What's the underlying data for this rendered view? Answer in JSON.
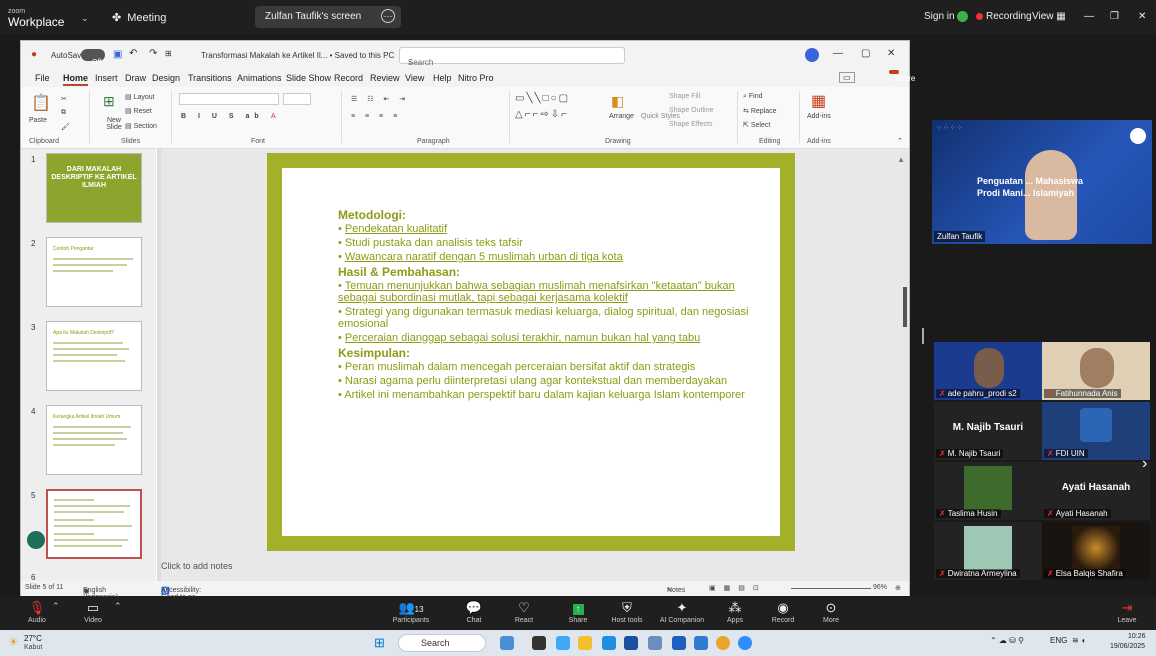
{
  "zoom": {
    "logo_top": "zoom",
    "logo_bottom": "Workplace",
    "meeting_label": "Meeting",
    "screen_tab": "Zulfan Taufik's screen",
    "sign_in": "Sign in",
    "recording": "Recording",
    "view": "View"
  },
  "ppt": {
    "autosave": "AutoSave",
    "autosave_state": "Off",
    "doc_title": "Transformasi Makalah ke Artikel Il... • Saved to this PC",
    "search_placeholder": "Search",
    "menu": [
      "File",
      "Home",
      "Insert",
      "Draw",
      "Design",
      "Transitions",
      "Animations",
      "Slide Show",
      "Record",
      "Review",
      "View",
      "Help",
      "Nitro Pro"
    ],
    "share_label": "Share",
    "ribbon_groups": [
      "Clipboard",
      "Slides",
      "Font",
      "Paragraph",
      "Drawing",
      "Editing",
      "Add-ins"
    ],
    "ribbon_items": {
      "paste": "Paste",
      "new_slide": "New Slide",
      "layout": "Layout",
      "reset": "Reset",
      "section": "Section",
      "arrange": "Arrange",
      "quick_styles": "Quick Styles",
      "shape_fill": "Shape Fill",
      "shape_outline": "Shape Outline",
      "shape_effects": "Shape Effects",
      "find": "Find",
      "replace": "Replace",
      "select": "Select",
      "addins": "Add-ins"
    },
    "thumb1_title": "DARI MAKALAH DESKRIPTIF KE ARTIKEL ILMIAH",
    "thumb_titles": [
      "Contoh Pengantar",
      "Apa itu Makalah Deskriptif?",
      "Kerangka Artikel Ilmiah Umum"
    ],
    "slide": {
      "metodologi_h": "Metodologi:",
      "metodologi": [
        "Pendekatan kualitatif",
        "Studi pustaka dan analisis teks tafsir",
        "Wawancara naratif dengan 5 muslimah urban di tiga kota"
      ],
      "hasil_h": "Hasil & Pembahasan:",
      "hasil": [
        "Temuan menunjukkan bahwa sebagian muslimah menafsirkan \"ketaatan\" bukan sebagai subordinasi mutlak, tapi sebagai kerjasama kolektif",
        "Strategi yang digunakan termasuk mediasi keluarga, dialog spiritual, dan negosiasi emosional",
        "Perceraian dianggap sebagai solusi terakhir, namun bukan hal yang tabu"
      ],
      "kesimpulan_h": "Kesimpulan:",
      "kesimpulan": [
        "Peran muslimah dalam mencegah perceraian bersifat aktif dan strategis",
        "Narasi agama perlu diinterpretasi ulang agar kontekstual dan memberdayakan",
        "Artikel ini menambahkan perspektif baru dalam kajian keluarga Islam kontemporer"
      ]
    },
    "notes_placeholder": "Click to add notes",
    "status_slide": "Slide 5 of 11",
    "status_lang": "English (Indonesia)",
    "status_access": "Accessibility: Good to go",
    "status_notes": "Notes",
    "status_zoom": "96%"
  },
  "participants": {
    "speaker_name": "Zulfan Taufik",
    "speaker_bg_line1": "Penguatan ... Mahasiswa",
    "speaker_bg_line2": "Prodi Mani... Islamiyah",
    "tiles": [
      {
        "name": "ade pahru_prodi s2"
      },
      {
        "name": "Fatihunnada Anis"
      },
      {
        "name": "M. Najib Tsauri",
        "big": "M. Najib Tsauri"
      },
      {
        "name": "FDI UIN"
      },
      {
        "name": "Taslima Husin"
      },
      {
        "name": "Ayati Hasanah",
        "big": "Ayati Hasanah"
      },
      {
        "name": "Dwiratna Armeylina"
      },
      {
        "name": "Elsa Balqis Shafira"
      }
    ]
  },
  "toolbar": {
    "audio": "Audio",
    "video": "Video",
    "participants": "Participants",
    "participants_count": "13",
    "chat": "Chat",
    "react": "React",
    "share": "Share",
    "host_tools": "Host tools",
    "ai": "AI Companion",
    "apps": "Apps",
    "record": "Record",
    "more": "More",
    "leave": "Leave"
  },
  "taskbar": {
    "weather_temp": "27°C",
    "weather_desc": "Kabut",
    "search": "Search",
    "lang": "ENG",
    "time": "10:26",
    "date": "19/06/2025"
  },
  "colors": {
    "zoom_bg": "#1f1f1f",
    "slide_accent": "#a2b02a",
    "ppt_accent": "#c43e1c",
    "recording": "#e33333"
  }
}
